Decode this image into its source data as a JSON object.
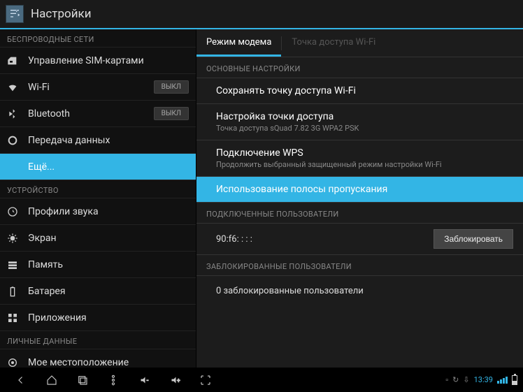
{
  "header": {
    "title": "Настройки"
  },
  "sections": {
    "wireless": "БЕСПРОВОДНЫЕ СЕТИ",
    "device": "УСТРОЙСТВО",
    "personal": "ЛИЧНЫЕ ДАННЫЕ"
  },
  "sidebar": {
    "sim": "Управление SIM-картами",
    "wifi": "Wi-Fi",
    "bluetooth": "Bluetooth",
    "data": "Передача данных",
    "more": "Ещё...",
    "sound": "Профили звука",
    "display": "Экран",
    "storage": "Память",
    "battery": "Батарея",
    "apps": "Приложения",
    "location": "Мое местоположение",
    "toggle_off": "ВЫКЛ"
  },
  "tabs": {
    "tethering": "Режим модема",
    "hotspot": "Точка доступа Wi-Fi"
  },
  "content": {
    "basic": "ОСНОВНЫЕ НАСТРОЙКИ",
    "keep_ap": "Сохранять точку доступа Wi-Fi",
    "ap_setup": "Настройка точки доступа",
    "ap_setup_sub": "Точка доступа sQuad 7.82 3G WPA2 PSK",
    "wps": "Подключение WPS",
    "wps_sub": "Продолжить выбранный защищенный режим настройки Wi-Fi",
    "bandwidth": "Использование полосы пропускания",
    "connected": "ПОДКЛЮЧЕННЫЕ ПОЛЬЗОВАТЕЛИ",
    "mac": "90:f6:   :   :   :",
    "block": "Заблокировать",
    "blocked": "ЗАБЛОКИРОВАННЫЕ ПОЛЬЗОВАТЕЛИ",
    "blocked_count": "0 заблокированные пользователи"
  },
  "status": {
    "time": "13:39"
  }
}
